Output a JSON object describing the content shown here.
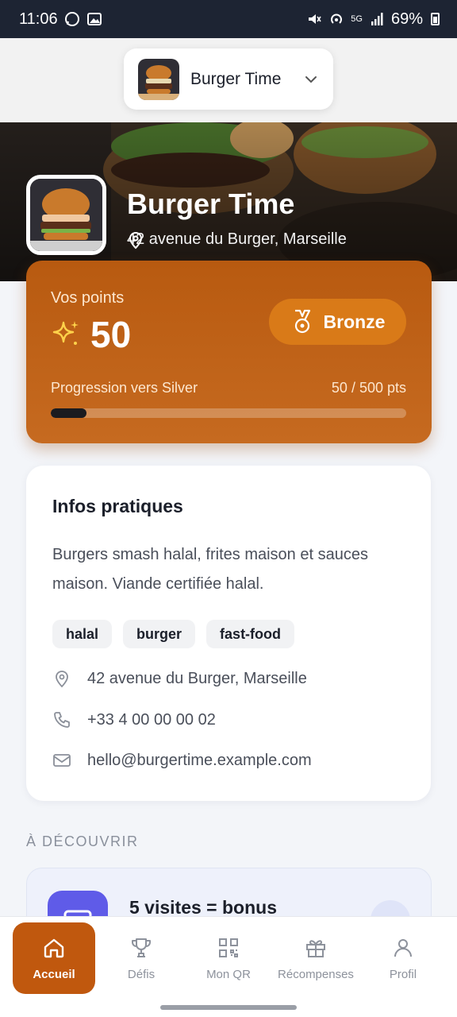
{
  "status_bar": {
    "time": "11:06",
    "battery": "69%",
    "network": "5G"
  },
  "selector": {
    "name": "Burger Time"
  },
  "hero": {
    "title": "Burger Time",
    "address": "42 avenue du Burger, Marseille"
  },
  "points": {
    "label": "Vos points",
    "value": "50",
    "tier": "Bronze",
    "progress_label": "Progression vers Silver",
    "progress_count": "50 / 500 pts",
    "progress_fraction": 0.1
  },
  "info": {
    "title": "Infos pratiques",
    "description": "Burgers smash halal, frites maison et sauces maison. Viande certifiée halal.",
    "tags": [
      "halal",
      "burger",
      "fast-food"
    ],
    "address": "42 avenue du Burger, Marseille",
    "phone": "+33 4 00 00 00 02",
    "email": "hello@burgertime.example.com"
  },
  "discover": {
    "heading": "À DÉCOUVRIR",
    "promo_title": "5 visites = bonus"
  },
  "nav": [
    {
      "label": "Accueil",
      "icon": "home-icon",
      "active": true
    },
    {
      "label": "Défis",
      "icon": "trophy-icon"
    },
    {
      "label": "Mon QR",
      "icon": "qr-code-icon"
    },
    {
      "label": "Récompenses",
      "icon": "gift-icon"
    },
    {
      "label": "Profil",
      "icon": "user-icon"
    }
  ],
  "colors": {
    "accent": "#c0580e",
    "tier": "#d97a18",
    "promo_icon": "#5f5be8"
  }
}
